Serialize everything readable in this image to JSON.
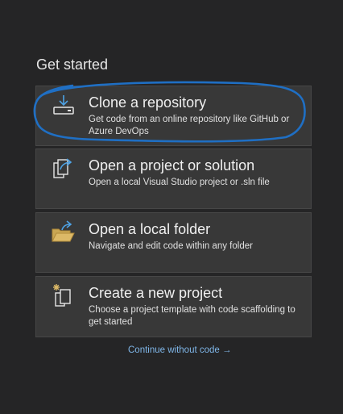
{
  "heading": "Get started",
  "cards": [
    {
      "title": "Clone a repository",
      "description": "Get code from an online repository like GitHub or Azure DevOps",
      "icon": "clone-download-icon"
    },
    {
      "title": "Open a project or solution",
      "description": "Open a local Visual Studio project or .sln file",
      "icon": "open-project-icon"
    },
    {
      "title": "Open a local folder",
      "description": "Navigate and edit code within any folder",
      "icon": "open-folder-icon"
    },
    {
      "title": "Create a new project",
      "description": "Choose a project template with code scaffolding to get started",
      "icon": "new-project-icon"
    }
  ],
  "continue_link": "Continue without code →",
  "colors": {
    "background": "#252526",
    "card": "#383838",
    "accent_blue": "#4ea3e6",
    "annotation_ink": "#1f6fc4",
    "folder_yellow": "#dcb967"
  }
}
